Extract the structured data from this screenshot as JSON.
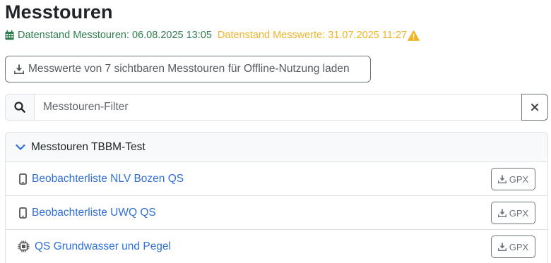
{
  "page": {
    "title": "Messtouren"
  },
  "status": {
    "tours_label": "Datenstand Messtouren: 06.08.2025 13:05",
    "values_label": "Datenstand Messwerte: 31.07.2025 11:27",
    "ok_color": "#2e7d4f",
    "warn_color": "#f0b429"
  },
  "offline_button": {
    "label": "Messwerte von 7 sichtbaren Messtouren für Offline-Nutzung laden",
    "icon": "download-icon"
  },
  "filter": {
    "placeholder": "Messtouren-Filter",
    "search_icon": "search-icon",
    "clear_icon": "close-icon"
  },
  "group": {
    "title": "Messtouren TBBM-Test",
    "expanded": true,
    "items": [
      {
        "label": "Beobachterliste NLV Bozen QS",
        "icon": "phone-icon",
        "action_label": "GPX"
      },
      {
        "label": "Beobachterliste UWQ QS",
        "icon": "phone-icon",
        "action_label": "GPX"
      },
      {
        "label": "QS Grundwasser und Pegel",
        "icon": "chip-icon",
        "action_label": "GPX"
      }
    ]
  },
  "colors": {
    "link": "#2f6fd6",
    "chevron": "#2f6fd6"
  }
}
